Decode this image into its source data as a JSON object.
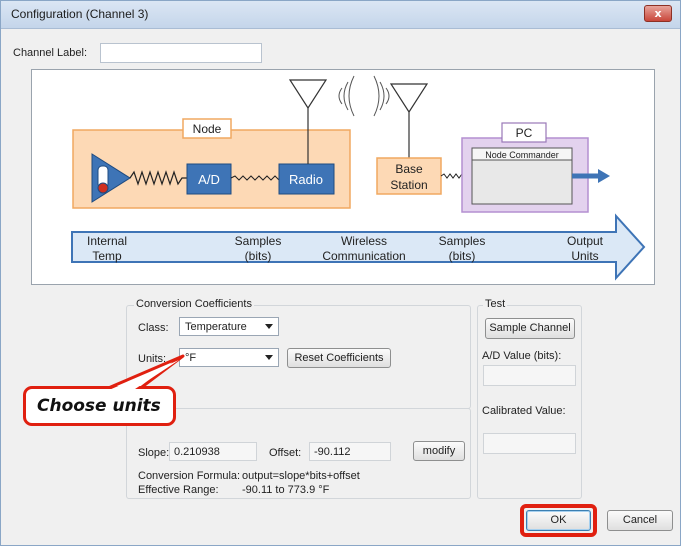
{
  "window": {
    "title": "Configuration (Channel 3)",
    "close_label": "x"
  },
  "channel_label": {
    "label": "Channel Label:",
    "value": ""
  },
  "diagram": {
    "node_label": "Node",
    "ad_label": "A/D",
    "radio_label": "Radio",
    "base_station_line1": "Base",
    "base_station_line2": "Station",
    "pc_label": "PC",
    "node_commander_label": "Node Commander",
    "flow_labels": [
      {
        "line1": "Internal",
        "line2": "Temp"
      },
      {
        "line1": "Samples",
        "line2": "(bits)"
      },
      {
        "line1": "Wireless",
        "line2": "Communication"
      },
      {
        "line1": "Samples",
        "line2": "(bits)"
      },
      {
        "line1": "Output",
        "line2": "Units"
      }
    ],
    "colors": {
      "node_fill": "#fdd9b5",
      "node_border": "#f0a860",
      "pc_fill": "#e3d2ee",
      "pc_border": "#b48fd0",
      "blue": "#3e74b6",
      "flow_fill": "#dbe8f6"
    }
  },
  "conversion": {
    "group_label": "Conversion Coefficients",
    "class_label": "Class:",
    "class_value": "Temperature",
    "units_label": "Units:",
    "units_value": "°F",
    "reset_label": "Reset Coefficients",
    "slope_label": "Slope:",
    "slope_value": "0.210938",
    "offset_label": "Offset:",
    "offset_value": "-90.112",
    "modify_label": "modify",
    "formula_label": "Conversion Formula:",
    "formula_value": "output=slope*bits+offset",
    "range_label": "Effective Range:",
    "range_value": "-90.11 to 773.9 °F"
  },
  "test": {
    "group_label": "Test",
    "sample_label": "Sample Channel",
    "ad_value_label": "A/D Value (bits):",
    "ad_value": "",
    "calibrated_label": "Calibrated Value:",
    "calibrated_value": ""
  },
  "footer": {
    "ok_label": "OK",
    "cancel_label": "Cancel"
  },
  "annotation": {
    "callout_text": "Choose units",
    "highlight_color": "#e02010"
  }
}
